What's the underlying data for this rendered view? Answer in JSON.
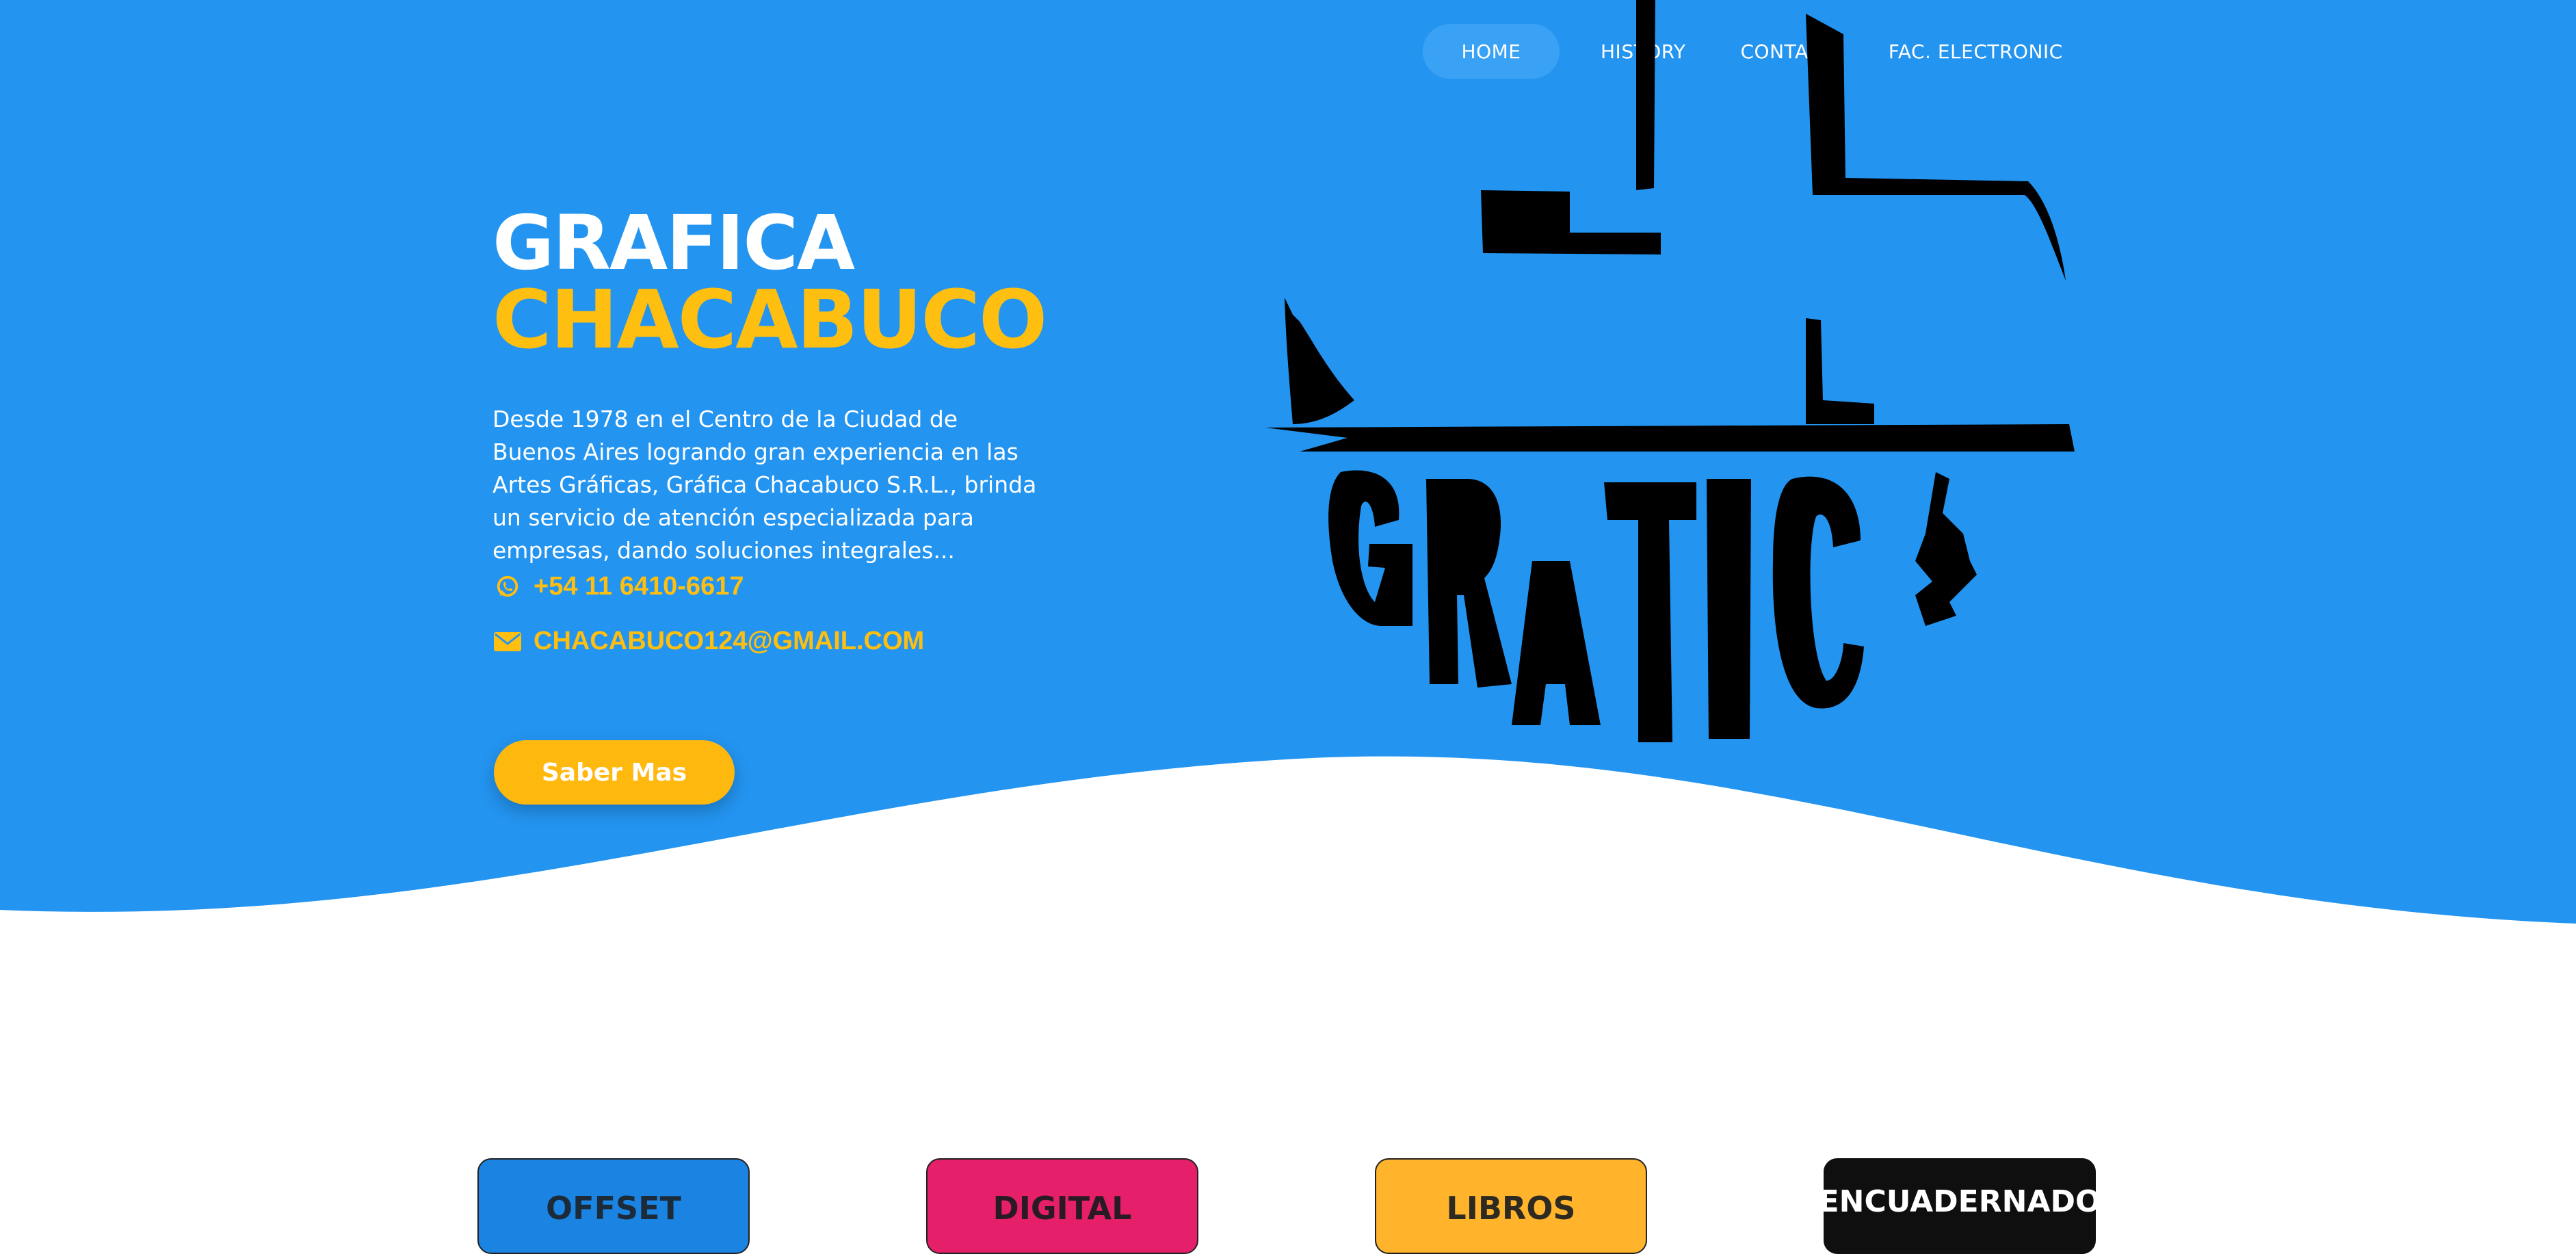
{
  "nav": {
    "items": [
      {
        "label": "HOME",
        "active": true
      },
      {
        "label": "HISTORY",
        "active": false
      },
      {
        "label": "CONTACT",
        "active": false
      },
      {
        "label": "FAC. ELECTRONIC",
        "active": false
      }
    ]
  },
  "hero": {
    "title_line1": "GRAFICA",
    "title_line2": "CHACABUCO",
    "description": "Desde 1978 en el Centro de la Ciudad de Buenos Aires logrando gran experiencia en las Artes Gráficas, Gráfica Chacabuco S.R.L., brinda un servicio de atención especializada para empresas, dando soluciones integrales...",
    "phone": "+54 11 6410-6617",
    "phone_icon": "whatsapp-icon",
    "email": "CHACABUCO124@GMAIL.COM",
    "email_icon": "envelope-icon",
    "cta_label": "Saber Mas",
    "logo_text": "GRATIC"
  },
  "services": {
    "cards": [
      {
        "label": "OFFSET",
        "color": "#1b84e2"
      },
      {
        "label": "DIGITAL",
        "color": "#e51f6a"
      },
      {
        "label": "LIBROS",
        "color": "#ffb42c"
      },
      {
        "label": "ENCUADERNADO",
        "color": "#0f0f0f"
      }
    ]
  },
  "colors": {
    "hero_bg": "#2394f0",
    "accent_yellow": "#ffbf10",
    "text_white": "#ffffff"
  }
}
